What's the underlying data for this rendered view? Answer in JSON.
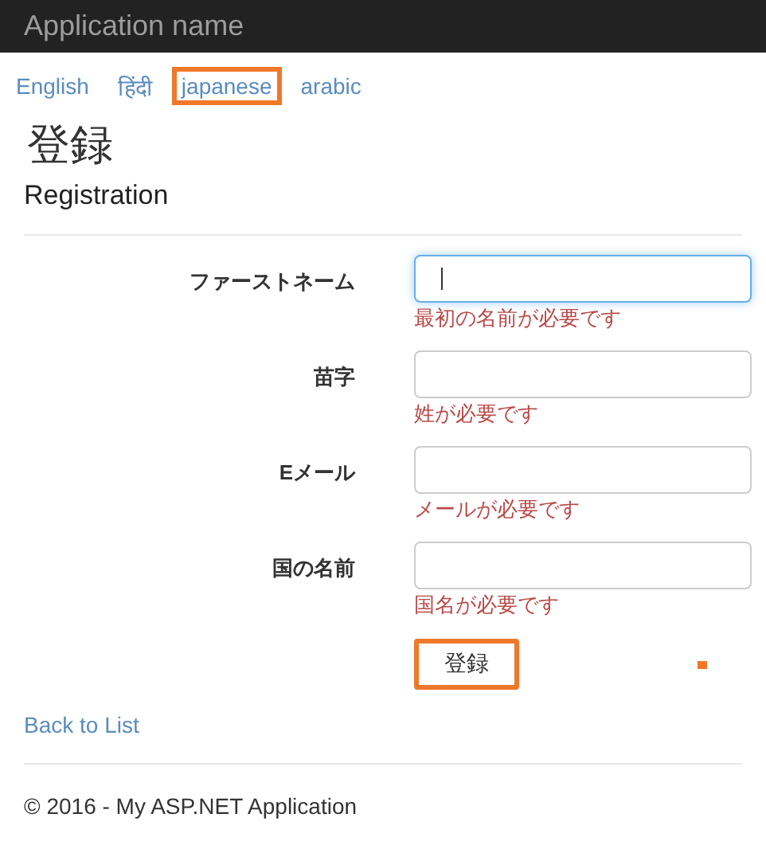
{
  "navbar": {
    "brand": "Application name"
  },
  "languages": [
    {
      "label": "English",
      "highlighted": false
    },
    {
      "label": "हिंदी",
      "highlighted": false
    },
    {
      "label": "japanese",
      "highlighted": true
    },
    {
      "label": "arabic",
      "highlighted": false
    }
  ],
  "heading": "登録",
  "subheading": "Registration",
  "fields": [
    {
      "label": "ファーストネーム",
      "focused": true,
      "error": "最初の名前が必要です"
    },
    {
      "label": "苗字",
      "focused": false,
      "error": "姓が必要です"
    },
    {
      "label": "Eメール",
      "focused": false,
      "error": "メールが必要です"
    },
    {
      "label": "国の名前",
      "focused": false,
      "error": "国名が必要です"
    }
  ],
  "submit": {
    "label": "登録",
    "highlighted": true
  },
  "back_link": "Back to List",
  "footer": "© 2016 - My ASP.NET Application"
}
